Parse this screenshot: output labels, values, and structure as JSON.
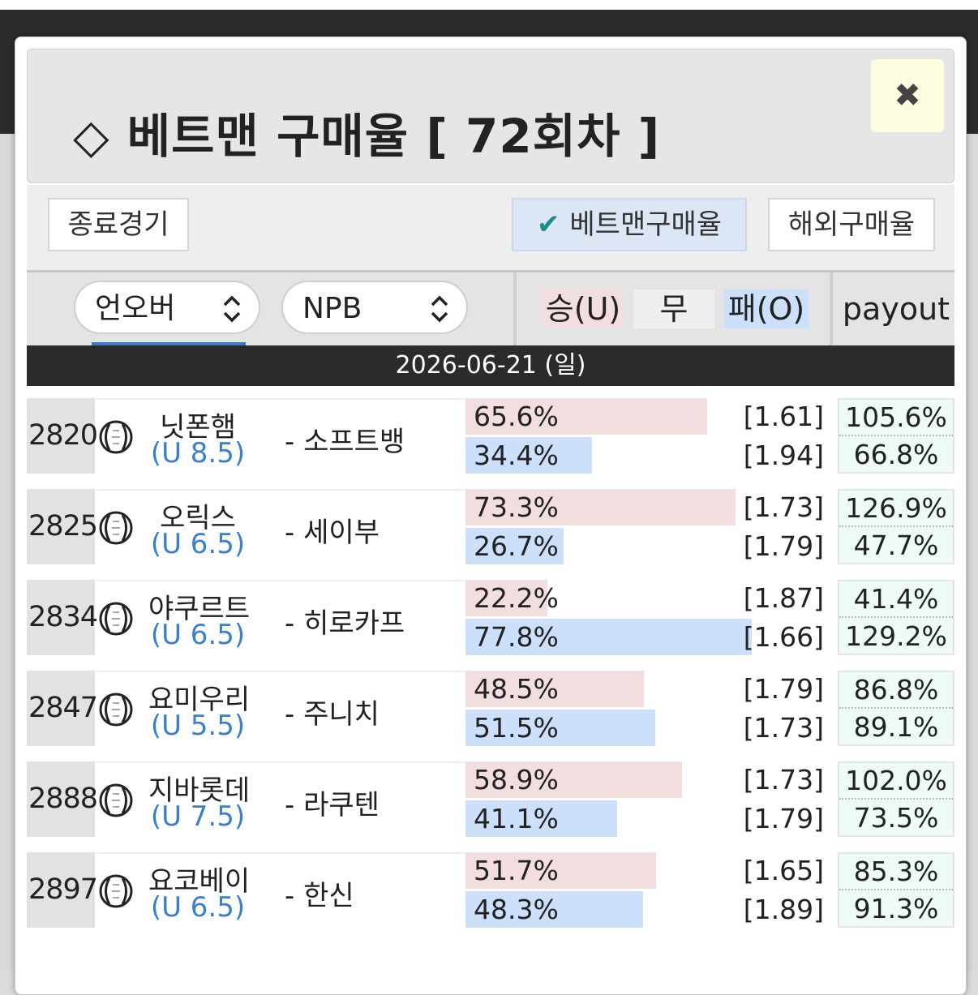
{
  "modal": {
    "title": "◇ 베트맨 구매율 [ 72회차 ]",
    "close_icon": "✖"
  },
  "toolbar": {
    "finished_label": "종료경기",
    "betman_label": "베트맨구매율",
    "betman_check": "✔",
    "overseas_label": "해외구매율"
  },
  "filters": {
    "type_value": "언오버",
    "league_value": "NPB",
    "chevron": "⌃⌄"
  },
  "columns": {
    "under": "승(U)",
    "draw": "무",
    "over": "패(O)",
    "payout": "payout"
  },
  "colors": {
    "under_bg": "#f2dede",
    "over_bg": "#cde0fb",
    "line_text": "#3b7fd0",
    "payout_bg": "#eefaf5"
  },
  "date": "2026-06-21 (일)",
  "games": [
    {
      "no": "2820",
      "home": "닛폰햄",
      "line": "(U 8.5)",
      "away": "- 소프트뱅",
      "u_pct": "65.6%",
      "o_pct": "34.4%",
      "u_val": 65.6,
      "o_val": 34.4,
      "u_odds": "[1.61]",
      "o_odds": "[1.94]",
      "u_pay": "105.6%",
      "o_pay": "66.8%",
      "icon": "baseball-icon"
    },
    {
      "no": "2825",
      "home": "오릭스",
      "line": "(U 6.5)",
      "away": "- 세이부",
      "u_pct": "73.3%",
      "o_pct": "26.7%",
      "u_val": 73.3,
      "o_val": 26.7,
      "u_odds": "[1.73]",
      "o_odds": "[1.79]",
      "u_pay": "126.9%",
      "o_pay": "47.7%",
      "icon": "baseball-icon"
    },
    {
      "no": "2834",
      "home": "야쿠르트",
      "line": "(U 6.5)",
      "away": "- 히로카프",
      "u_pct": "22.2%",
      "o_pct": "77.8%",
      "u_val": 22.2,
      "o_val": 77.8,
      "u_odds": "[1.87]",
      "o_odds": "[1.66]",
      "u_pay": "41.4%",
      "o_pay": "129.2%",
      "icon": "baseball-icon"
    },
    {
      "no": "2847",
      "home": "요미우리",
      "line": "(U 5.5)",
      "away": "- 주니치",
      "u_pct": "48.5%",
      "o_pct": "51.5%",
      "u_val": 48.5,
      "o_val": 51.5,
      "u_odds": "[1.79]",
      "o_odds": "[1.73]",
      "u_pay": "86.8%",
      "o_pay": "89.1%",
      "icon": "baseball-icon"
    },
    {
      "no": "2888",
      "home": "지바롯데",
      "line": "(U 7.5)",
      "away": "- 라쿠텐",
      "u_pct": "58.9%",
      "o_pct": "41.1%",
      "u_val": 58.9,
      "o_val": 41.1,
      "u_odds": "[1.73]",
      "o_odds": "[1.79]",
      "u_pay": "102.0%",
      "o_pay": "73.5%",
      "icon": "baseball-icon"
    },
    {
      "no": "2897",
      "home": "요코베이",
      "line": "(U 6.5)",
      "away": "- 한신",
      "u_pct": "51.7%",
      "o_pct": "48.3%",
      "u_val": 51.7,
      "o_val": 48.3,
      "u_odds": "[1.65]",
      "o_odds": "[1.89]",
      "u_pay": "85.3%",
      "o_pay": "91.3%",
      "icon": "baseball-icon"
    }
  ]
}
